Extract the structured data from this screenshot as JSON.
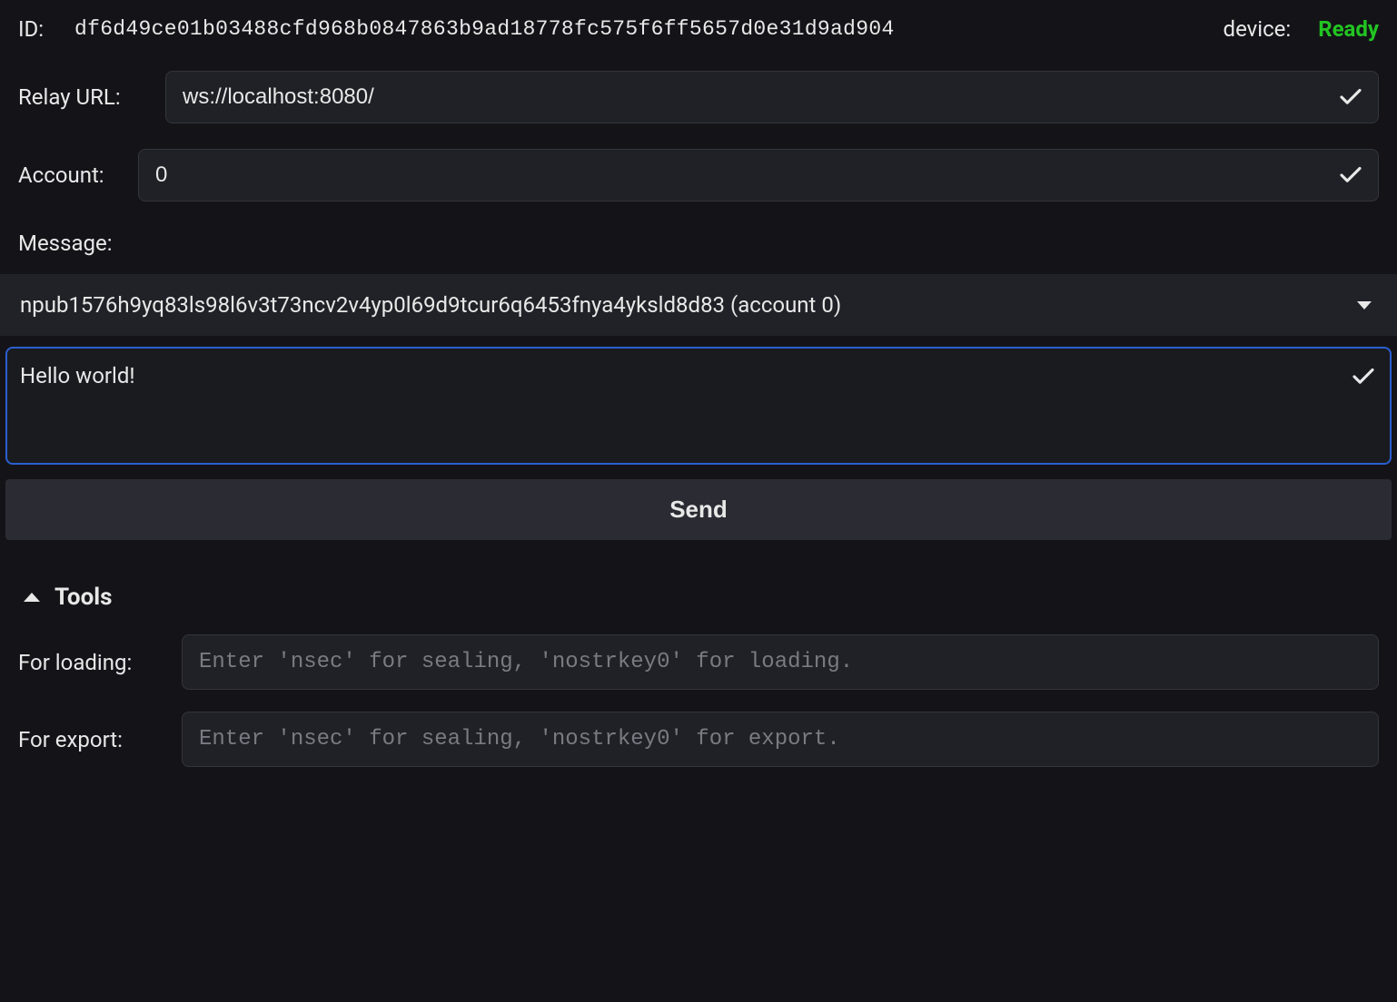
{
  "header": {
    "id_label": "ID:",
    "id_value": "df6d49ce01b03488cfd968b0847863b9ad18778fc575f6ff5657d0e31d9ad904",
    "device_label": "device:",
    "device_status": "Ready"
  },
  "relay": {
    "label": "Relay URL:",
    "value": "ws://localhost:8080/"
  },
  "account": {
    "label": "Account:",
    "value": "0"
  },
  "message": {
    "label": "Message:",
    "selected_key": "npub1576h9yq83ls98l6v3t73ncv2v4yp0l69d9tcur6q6453fnya4yksld8d83 (account 0)",
    "body": "Hello world!"
  },
  "send": {
    "label": "Send"
  },
  "tools": {
    "title": "Tools",
    "loading": {
      "label": "For loading:",
      "placeholder": "Enter 'nsec' for sealing, 'nostrkey0' for loading."
    },
    "export": {
      "label": "For export:",
      "placeholder": "Enter 'nsec' for sealing, 'nostrkey0' for export."
    }
  }
}
